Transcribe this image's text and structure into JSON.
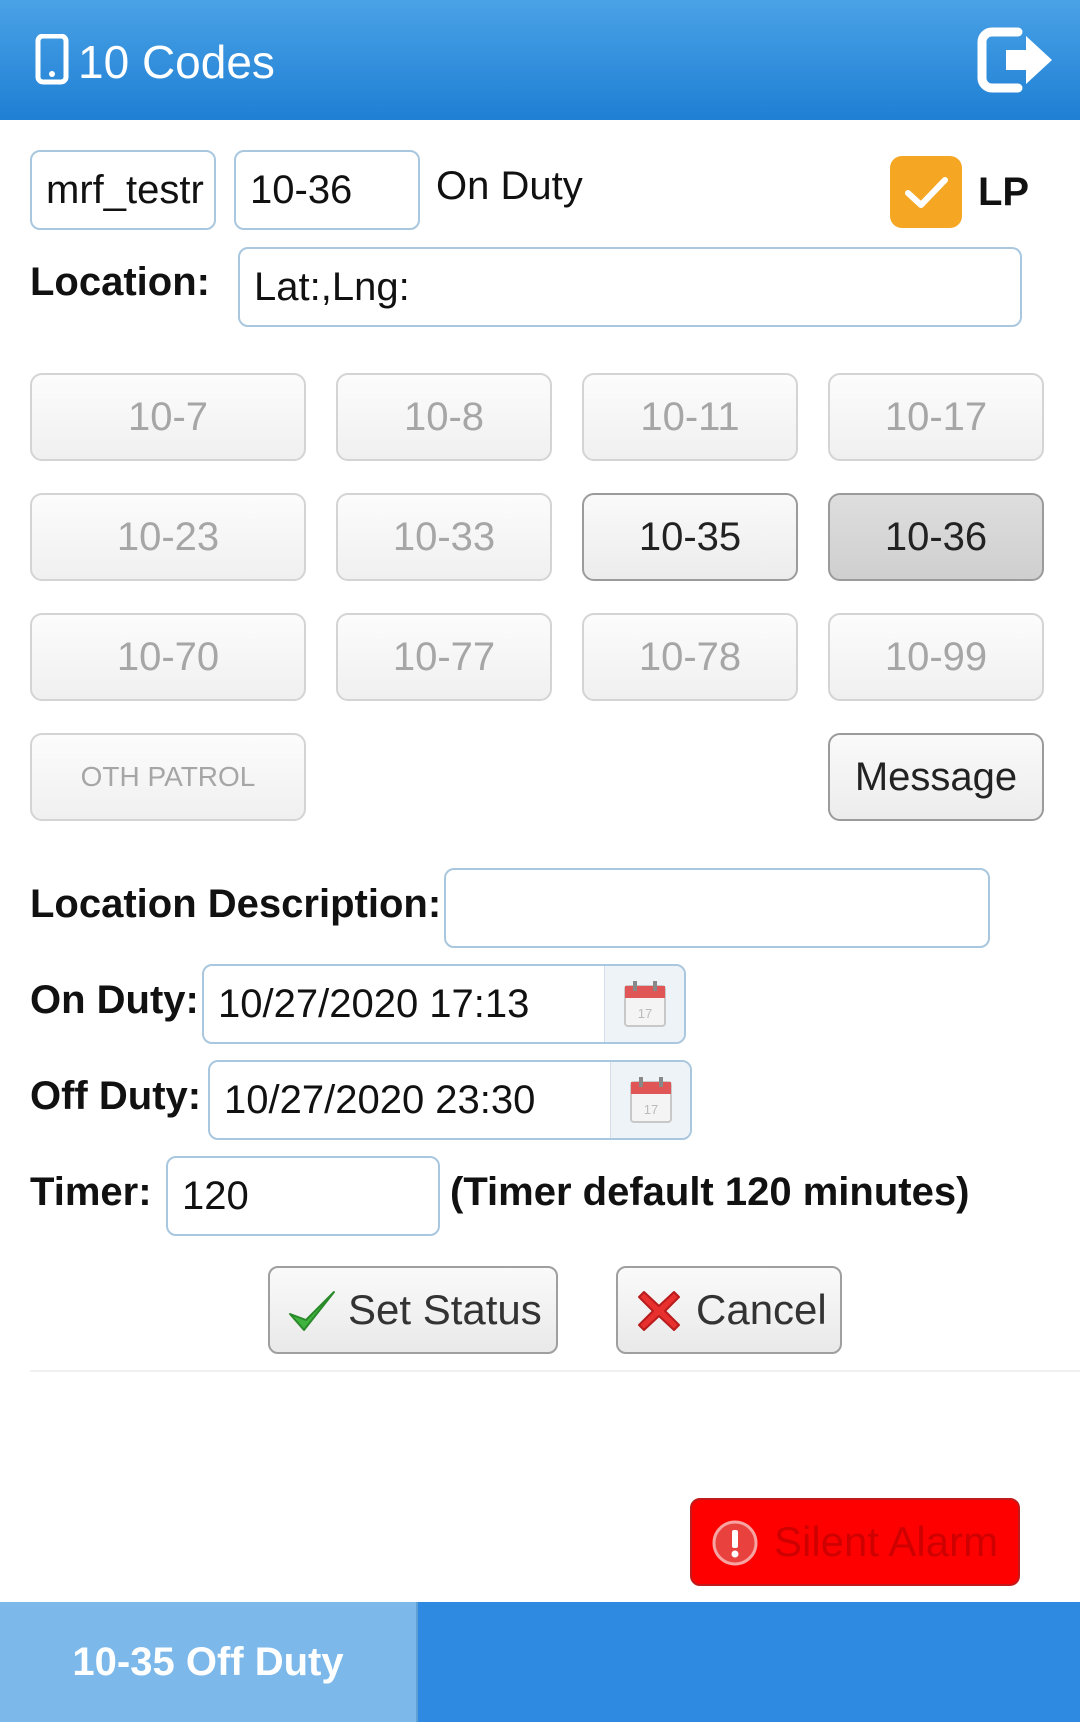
{
  "header": {
    "title": "10 Codes",
    "icons": [
      "phone-icon",
      "logout-icon"
    ]
  },
  "top_row": {
    "unit_value": "mrf_testr",
    "code_value": "10-36",
    "status_text": "On Duty",
    "lp_checked": true,
    "lp_label": "LP"
  },
  "location": {
    "label": "Location:",
    "value": "Lat:,Lng:"
  },
  "codes": [
    {
      "label": "10-7",
      "state": "disabled"
    },
    {
      "label": "10-8",
      "state": "disabled"
    },
    {
      "label": "10-11",
      "state": "disabled"
    },
    {
      "label": "10-17",
      "state": "disabled"
    },
    {
      "label": "10-23",
      "state": "disabled"
    },
    {
      "label": "10-33",
      "state": "disabled"
    },
    {
      "label": "10-35",
      "state": "enabled"
    },
    {
      "label": "10-36",
      "state": "selected"
    },
    {
      "label": "10-70",
      "state": "disabled"
    },
    {
      "label": "10-77",
      "state": "disabled"
    },
    {
      "label": "10-78",
      "state": "disabled"
    },
    {
      "label": "10-99",
      "state": "disabled"
    },
    {
      "label": "OTH PATROL",
      "state": "disabled"
    },
    {
      "label": "Message",
      "state": "enabled"
    }
  ],
  "form": {
    "location_description_label": "Location Description:",
    "location_description_value": "",
    "on_duty_label": "On Duty:",
    "on_duty_value": "10/27/2020 17:13",
    "off_duty_label": "Off Duty:",
    "off_duty_value": "10/27/2020 23:30",
    "timer_label": "Timer:",
    "timer_value": "120",
    "timer_note": "(Timer default 120 minutes)"
  },
  "actions": {
    "set_status_label": "Set Status",
    "cancel_label": "Cancel"
  },
  "alarm": {
    "label": "Silent Alarm"
  },
  "footer": {
    "tab_label": "10-35 Off Duty"
  },
  "colors": {
    "header": "#2b8ae0",
    "lp_checkbox": "#f5a623",
    "alarm": "#ff0000",
    "footer_tab": "#7cb9ea"
  }
}
